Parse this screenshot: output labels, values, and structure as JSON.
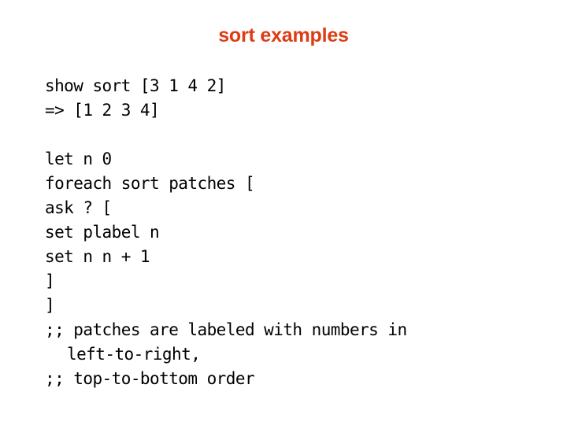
{
  "slide": {
    "title": "sort examples",
    "title_color": "#dd3c14",
    "background_color": "#ffffff",
    "text_color": "#000000",
    "body_lines": [
      {
        "text": "show sort [3 1 4 2]",
        "kind": "code",
        "indent": 0
      },
      {
        "text": "=> [1 2 3 4]",
        "kind": "code",
        "indent": 0
      },
      {
        "text": "",
        "kind": "blank",
        "indent": 0
      },
      {
        "text": "let n 0",
        "kind": "code",
        "indent": 0
      },
      {
        "text": "foreach sort patches [",
        "kind": "code",
        "indent": 0
      },
      {
        "text": "ask ? [",
        "kind": "code",
        "indent": 0
      },
      {
        "text": "set plabel n",
        "kind": "code",
        "indent": 0
      },
      {
        "text": "set n n + 1",
        "kind": "code",
        "indent": 0
      },
      {
        "text": "]",
        "kind": "code",
        "indent": 0
      },
      {
        "text": "]",
        "kind": "code",
        "indent": 0
      },
      {
        "text": ";; patches are labeled with numbers in",
        "kind": "comment",
        "indent": 0
      },
      {
        "text": "left-to-right,",
        "kind": "continuation",
        "indent": 2
      },
      {
        "text": ";; top-to-bottom order",
        "kind": "comment",
        "indent": 0
      }
    ]
  }
}
